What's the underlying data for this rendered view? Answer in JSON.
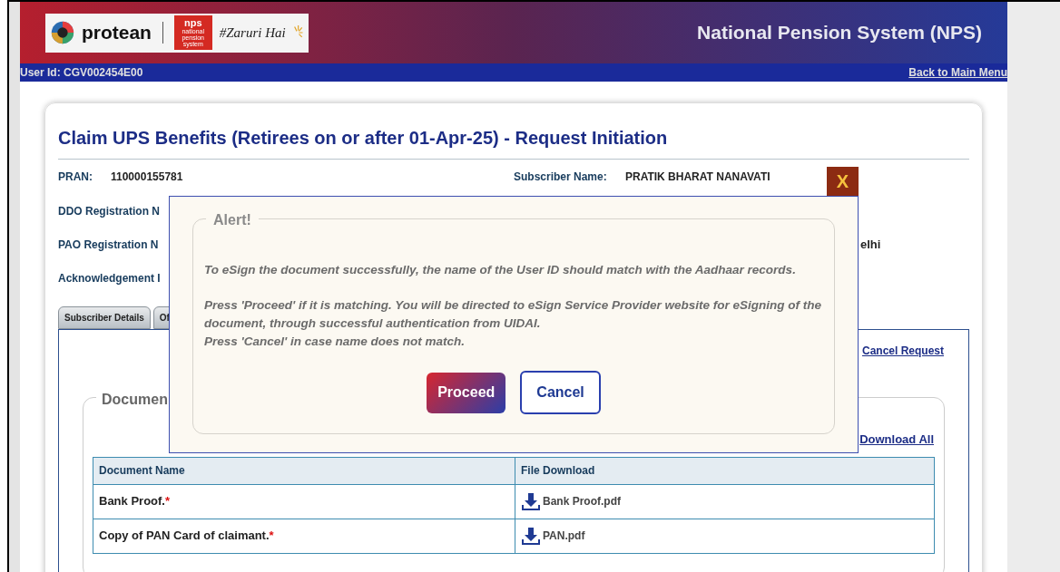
{
  "header": {
    "brand": "protean",
    "badge": "nps",
    "badge_caption": "national pension system",
    "tagline": "#Zaruri Hai",
    "title": "National Pension System (NPS)"
  },
  "user_bar": {
    "user_id": "User Id: CGV002454E00",
    "back_link": "Back to Main Menu"
  },
  "page_title": "Claim UPS Benefits (Retirees on or after 01-Apr-25) - Request Initiation",
  "pran": {
    "label": "PRAN:",
    "value": "110000155781"
  },
  "subscriber_name": {
    "label": "Subscriber Name:",
    "value": "PRATIK BHARAT NANAVATI"
  },
  "partial_labels": [
    "DDO Registration N",
    "PAO Registration N",
    "Acknowledgement I"
  ],
  "partial_value": "elhi",
  "tabs": [
    "Subscriber Details",
    "Of"
  ],
  "cancel_request": "Cancel Request",
  "documents": {
    "legend": "Documen",
    "download_all": "Download All",
    "columns": [
      "Document Name",
      "File Download"
    ],
    "rows": [
      {
        "name": "Bank Proof.",
        "mark": "*",
        "file": "Bank Proof.pdf"
      },
      {
        "name": "Copy of PAN Card of claimant.",
        "mark": "*",
        "file": "PAN.pdf"
      }
    ]
  },
  "modal": {
    "close": "X",
    "legend": "Alert!",
    "paragraphs": [
      [
        "To eSign the document successfully, the name of the User ID should match with the Aadhaar records."
      ],
      [
        "Press 'Proceed' if it is matching. You will be directed to eSign Service Provider website for eSigning of the document, through successful authentication from UIDAI.",
        "Press 'Cancel' in case name does not match."
      ]
    ],
    "buttons": [
      {
        "label": "Proceed",
        "kind": "primary"
      },
      {
        "label": "Cancel",
        "kind": "secondary"
      }
    ]
  }
}
